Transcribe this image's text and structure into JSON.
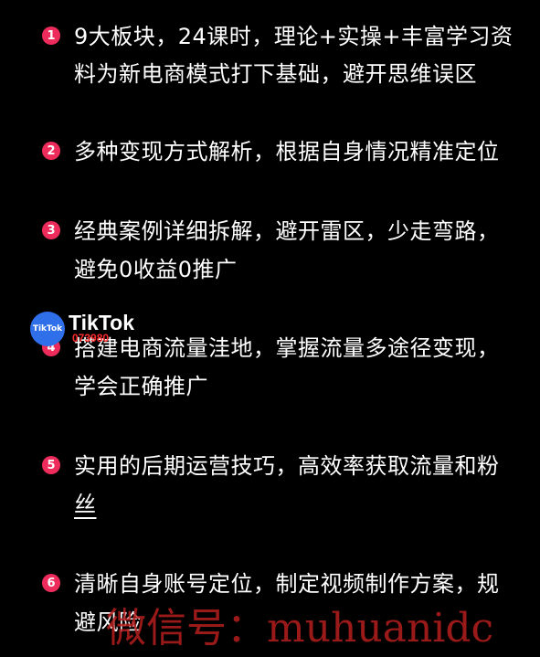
{
  "items": [
    {
      "num": "1",
      "lines": [
        "9大板块，24课时，理论+实操+丰富学习资",
        "料为新电商模式打下基础，避开思维误区"
      ]
    },
    {
      "num": "2",
      "lines": [
        "多种变现方式解析，根据自身情况精准定位"
      ]
    },
    {
      "num": "3",
      "lines": [
        "经典案例详细拆解，避开雷区，少走弯路，",
        "避免0收益0推广"
      ]
    },
    {
      "num": "4",
      "lines": [
        "搭建电商流量洼地，掌握流量多途径变现，",
        "学会正确推广"
      ]
    },
    {
      "num": "5",
      "lines": [
        "实用的后期运营技巧，高效率获取流量和粉",
        "丝"
      ]
    },
    {
      "num": "6",
      "lines": [
        "清晰自身账号定位，制定视频制作方案，规",
        "避风险"
      ]
    }
  ],
  "tiktok": {
    "badge": "TikTok",
    "title": "TikTok",
    "id": "073980"
  },
  "watermark": "微信号：muhuanidc",
  "colors": {
    "background": "#000000",
    "number_badge": "#ee2c5c",
    "text": "#ffffff",
    "watermark": "#b51e1e",
    "tiktok_badge": "#2f6fea"
  }
}
